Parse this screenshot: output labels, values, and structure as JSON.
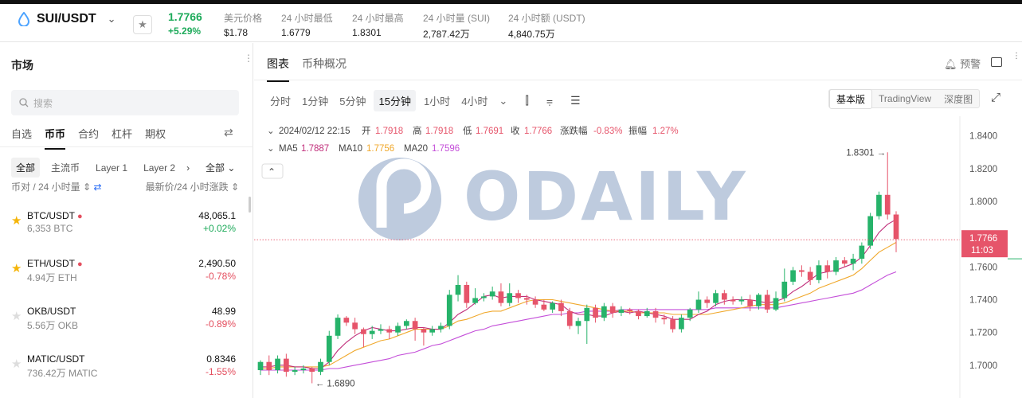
{
  "header": {
    "symbol": "SUI/USDT",
    "price": "1.7766",
    "change": "+5.29%",
    "stats": [
      {
        "label": "美元价格",
        "value": "$1.78"
      },
      {
        "label": "24 小时最低",
        "value": "1.6779"
      },
      {
        "label": "24 小时最高",
        "value": "1.8301"
      },
      {
        "label": "24 小时量 (SUI)",
        "value": "2,787.42万"
      },
      {
        "label": "24 小时额 (USDT)",
        "value": "4,840.75万"
      }
    ]
  },
  "sidebar": {
    "title": "市场",
    "search_placeholder": "搜索",
    "tabs": [
      "自选",
      "币币",
      "合约",
      "杠杆",
      "期权"
    ],
    "filters": [
      "全部",
      "主流币",
      "Layer 1",
      "Layer 2"
    ],
    "filter_all": "全部",
    "sort_left": "币对 / 24 小时量",
    "sort_right": "最新价/24 小时涨跌",
    "rows": [
      {
        "pair": "BTC/USDT",
        "hot": true,
        "vol": "6,353 BTC",
        "price": "48,065.1",
        "change": "+0.02%",
        "fav": true
      },
      {
        "pair": "ETH/USDT",
        "hot": true,
        "vol": "4.94万 ETH",
        "price": "2,490.50",
        "change": "-0.78%",
        "fav": true
      },
      {
        "pair": "OKB/USDT",
        "hot": false,
        "vol": "5.56万 OKB",
        "price": "48.99",
        "change": "-0.89%",
        "fav": false
      },
      {
        "pair": "MATIC/USDT",
        "hot": false,
        "vol": "736.42万 MATIC",
        "price": "0.8346",
        "change": "-1.55%",
        "fav": false
      }
    ]
  },
  "main": {
    "tabs": [
      "图表",
      "币种概况"
    ],
    "alert_label": "预警",
    "intervals": [
      "分时",
      "1分钟",
      "5分钟",
      "15分钟",
      "1小时",
      "4小时"
    ],
    "active_interval": "15分钟",
    "views": [
      "基本版",
      "TradingView",
      "深度图"
    ]
  },
  "chart_data": {
    "type": "candlestick",
    "info": {
      "datetime": "2024/02/12 22:15",
      "open_label": "开",
      "open": "1.7918",
      "high_label": "高",
      "high": "1.7918",
      "low_label": "低",
      "low": "1.7691",
      "close_label": "收",
      "close": "1.7766",
      "chg_label": "涨跌幅",
      "chg": "-0.83%",
      "amp_label": "振幅",
      "amp": "1.27%"
    },
    "ma": {
      "ma5_label": "MA5",
      "ma5": "1.7887",
      "ma10_label": "MA10",
      "ma10": "1.7756",
      "ma20_label": "MA20",
      "ma20": "1.7596"
    },
    "y_ticks": [
      "1.8400",
      "1.8200",
      "1.8000",
      "1.7600",
      "1.7400",
      "1.7200",
      "1.7000"
    ],
    "ylim": [
      1.68,
      1.852
    ],
    "current_price": "1.7766",
    "countdown": "11:03",
    "max_label": "1.8301",
    "min_label": "1.6890",
    "candles": [
      [
        1.697,
        1.702,
        1.694,
        1.703
      ],
      [
        1.702,
        1.697,
        1.694,
        1.706
      ],
      [
        1.697,
        1.704,
        1.695,
        1.706
      ],
      [
        1.704,
        1.696,
        1.693,
        1.707
      ],
      [
        1.696,
        1.697,
        1.694,
        1.699
      ],
      [
        1.697,
        1.698,
        1.695,
        1.7
      ],
      [
        1.698,
        1.696,
        1.689,
        1.699
      ],
      [
        1.696,
        1.702,
        1.694,
        1.704
      ],
      [
        1.702,
        1.718,
        1.7,
        1.721
      ],
      [
        1.718,
        1.729,
        1.716,
        1.731
      ],
      [
        1.729,
        1.726,
        1.724,
        1.73
      ],
      [
        1.726,
        1.722,
        1.719,
        1.729
      ],
      [
        1.722,
        1.719,
        1.711,
        1.723
      ],
      [
        1.719,
        1.721,
        1.716,
        1.724
      ],
      [
        1.721,
        1.722,
        1.719,
        1.725
      ],
      [
        1.722,
        1.72,
        1.716,
        1.724
      ],
      [
        1.72,
        1.724,
        1.718,
        1.726
      ],
      [
        1.724,
        1.727,
        1.722,
        1.728
      ],
      [
        1.727,
        1.722,
        1.715,
        1.729
      ],
      [
        1.722,
        1.72,
        1.712,
        1.723
      ],
      [
        1.72,
        1.722,
        1.718,
        1.724
      ],
      [
        1.722,
        1.724,
        1.72,
        1.726
      ],
      [
        1.724,
        1.743,
        1.722,
        1.746
      ],
      [
        1.743,
        1.749,
        1.739,
        1.755
      ],
      [
        1.749,
        1.738,
        1.735,
        1.751
      ],
      [
        1.738,
        1.741,
        1.737,
        1.747
      ],
      [
        1.741,
        1.742,
        1.739,
        1.744
      ],
      [
        1.742,
        1.745,
        1.74,
        1.748
      ],
      [
        1.745,
        1.738,
        1.736,
        1.75
      ],
      [
        1.738,
        1.744,
        1.736,
        1.75
      ],
      [
        1.744,
        1.741,
        1.738,
        1.746
      ],
      [
        1.741,
        1.74,
        1.737,
        1.743
      ],
      [
        1.74,
        1.737,
        1.735,
        1.742
      ],
      [
        1.737,
        1.734,
        1.733,
        1.74
      ],
      [
        1.734,
        1.738,
        1.732,
        1.739
      ],
      [
        1.738,
        1.733,
        1.73,
        1.74
      ],
      [
        1.733,
        1.724,
        1.722,
        1.735
      ],
      [
        1.724,
        1.727,
        1.719,
        1.729
      ],
      [
        1.727,
        1.735,
        1.713,
        1.737
      ],
      [
        1.735,
        1.729,
        1.726,
        1.737
      ],
      [
        1.729,
        1.736,
        1.727,
        1.738
      ],
      [
        1.736,
        1.732,
        1.729,
        1.738
      ],
      [
        1.732,
        1.734,
        1.73,
        1.736
      ],
      [
        1.734,
        1.733,
        1.731,
        1.735
      ],
      [
        1.733,
        1.73,
        1.728,
        1.734
      ],
      [
        1.73,
        1.733,
        1.729,
        1.735
      ],
      [
        1.733,
        1.729,
        1.726,
        1.735
      ],
      [
        1.729,
        1.728,
        1.725,
        1.731
      ],
      [
        1.728,
        1.722,
        1.72,
        1.73
      ],
      [
        1.722,
        1.729,
        1.72,
        1.731
      ],
      [
        1.729,
        1.734,
        1.727,
        1.735
      ],
      [
        1.734,
        1.74,
        1.732,
        1.745
      ],
      [
        1.74,
        1.738,
        1.735,
        1.742
      ],
      [
        1.738,
        1.744,
        1.736,
        1.746
      ],
      [
        1.744,
        1.74,
        1.737,
        1.746
      ],
      [
        1.74,
        1.739,
        1.737,
        1.742
      ],
      [
        1.739,
        1.74,
        1.737,
        1.742
      ],
      [
        1.74,
        1.736,
        1.733,
        1.743
      ],
      [
        1.736,
        1.743,
        1.734,
        1.744
      ],
      [
        1.743,
        1.734,
        1.732,
        1.746
      ],
      [
        1.734,
        1.741,
        1.733,
        1.745
      ],
      [
        1.741,
        1.751,
        1.739,
        1.759
      ],
      [
        1.751,
        1.758,
        1.749,
        1.76
      ],
      [
        1.758,
        1.757,
        1.754,
        1.761
      ],
      [
        1.757,
        1.752,
        1.749,
        1.76
      ],
      [
        1.752,
        1.761,
        1.75,
        1.764
      ],
      [
        1.761,
        1.757,
        1.753,
        1.764
      ],
      [
        1.757,
        1.764,
        1.755,
        1.766
      ],
      [
        1.764,
        1.762,
        1.76,
        1.766
      ],
      [
        1.762,
        1.765,
        1.758,
        1.768
      ],
      [
        1.765,
        1.773,
        1.762,
        1.775
      ],
      [
        1.773,
        1.791,
        1.771,
        1.793
      ],
      [
        1.791,
        1.804,
        1.789,
        1.806
      ],
      [
        1.804,
        1.792,
        1.789,
        1.83
      ],
      [
        1.792,
        1.777,
        1.769,
        1.794
      ]
    ],
    "ma5": [
      1.699,
      1.699,
      1.7,
      1.7,
      1.699,
      1.699,
      1.698,
      1.698,
      1.702,
      1.709,
      1.714,
      1.718,
      1.721,
      1.723,
      1.722,
      1.721,
      1.721,
      1.722,
      1.723,
      1.723,
      1.722,
      1.722,
      1.726,
      1.731,
      1.734,
      1.738,
      1.742,
      1.743,
      1.741,
      1.742,
      1.742,
      1.742,
      1.74,
      1.739,
      1.738,
      1.737,
      1.733,
      1.731,
      1.731,
      1.73,
      1.73,
      1.732,
      1.733,
      1.732,
      1.733,
      1.732,
      1.731,
      1.73,
      1.728,
      1.728,
      1.728,
      1.731,
      1.733,
      1.737,
      1.739,
      1.74,
      1.74,
      1.74,
      1.739,
      1.738,
      1.739,
      1.741,
      1.745,
      1.748,
      1.752,
      1.756,
      1.757,
      1.758,
      1.76,
      1.762,
      1.766,
      1.773,
      1.781,
      1.786,
      1.789
    ],
    "ma10": [
      1.698,
      1.698,
      1.699,
      1.699,
      1.699,
      1.699,
      1.699,
      1.699,
      1.7,
      1.703,
      1.706,
      1.709,
      1.711,
      1.713,
      1.715,
      1.716,
      1.718,
      1.72,
      1.722,
      1.722,
      1.722,
      1.722,
      1.724,
      1.727,
      1.728,
      1.73,
      1.732,
      1.733,
      1.733,
      1.735,
      1.737,
      1.739,
      1.74,
      1.74,
      1.74,
      1.739,
      1.738,
      1.737,
      1.736,
      1.735,
      1.734,
      1.733,
      1.733,
      1.733,
      1.732,
      1.732,
      1.732,
      1.732,
      1.731,
      1.731,
      1.731,
      1.731,
      1.731,
      1.732,
      1.733,
      1.734,
      1.735,
      1.736,
      1.737,
      1.737,
      1.737,
      1.738,
      1.74,
      1.742,
      1.744,
      1.747,
      1.749,
      1.751,
      1.753,
      1.755,
      1.759,
      1.764,
      1.769,
      1.772,
      1.775
    ],
    "ma20": [
      1.697,
      1.697,
      1.697,
      1.697,
      1.697,
      1.697,
      1.697,
      1.697,
      1.698,
      1.698,
      1.699,
      1.7,
      1.701,
      1.702,
      1.703,
      1.704,
      1.706,
      1.707,
      1.708,
      1.71,
      1.712,
      1.713,
      1.715,
      1.717,
      1.719,
      1.721,
      1.722,
      1.724,
      1.725,
      1.726,
      1.727,
      1.728,
      1.729,
      1.73,
      1.731,
      1.731,
      1.732,
      1.732,
      1.733,
      1.733,
      1.733,
      1.733,
      1.734,
      1.734,
      1.734,
      1.734,
      1.734,
      1.734,
      1.734,
      1.734,
      1.734,
      1.734,
      1.734,
      1.735,
      1.735,
      1.735,
      1.735,
      1.735,
      1.735,
      1.735,
      1.735,
      1.736,
      1.737,
      1.738,
      1.739,
      1.74,
      1.741,
      1.742,
      1.743,
      1.744,
      1.746,
      1.749,
      1.752,
      1.755,
      1.757
    ]
  },
  "colors": {
    "up": "#26b36a",
    "down": "#e6546a",
    "ma5": "#c02d7a",
    "ma10": "#f0a82b",
    "ma20": "#c44fd9",
    "price_line": "#e6546a"
  }
}
